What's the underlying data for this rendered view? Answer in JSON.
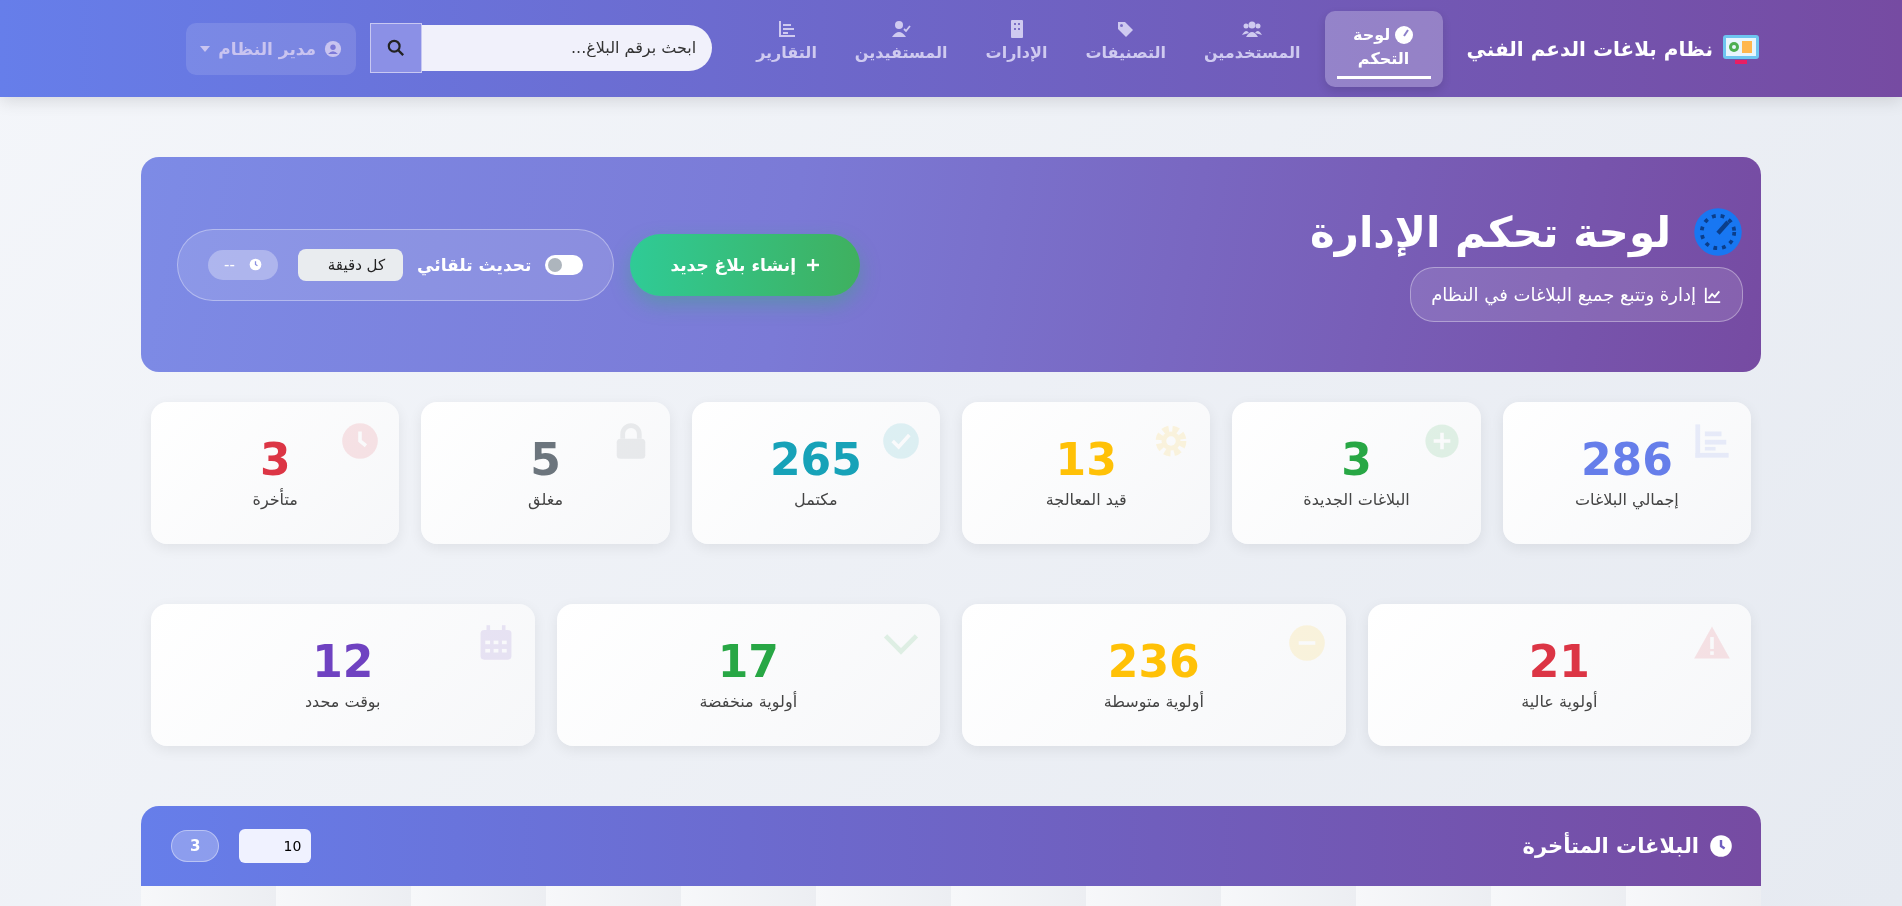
{
  "brand": {
    "title": "نظام بلاغات الدعم الفني"
  },
  "nav": [
    {
      "label": "لوحة التحكم",
      "selected": true
    },
    {
      "label": "المستخدمين",
      "selected": false
    },
    {
      "label": "التصنيفات",
      "selected": false
    },
    {
      "label": "الإدارات",
      "selected": false
    },
    {
      "label": "المستفيدين",
      "selected": false
    },
    {
      "label": "التقارير",
      "selected": false
    }
  ],
  "search": {
    "placeholder": "ابحث برقم البلاغ..."
  },
  "user": {
    "name": "مدير النظام"
  },
  "hero": {
    "title": "لوحة تحكم الإدارة",
    "subtitle": "إدارة وتتبع جميع البلاغات في النظام",
    "create_button": "إنشاء بلاغ جديد",
    "auto_refresh": {
      "label": "تحديث تلقائي",
      "on": false,
      "interval": "كل دقيقة",
      "last_update": "--"
    }
  },
  "stats": [
    {
      "value": "286",
      "label": "إجمالي البلاغات",
      "color": "#667eea"
    },
    {
      "value": "3",
      "label": "البلاغات الجديدة",
      "color": "#28a745"
    },
    {
      "value": "13",
      "label": "قيد المعالجة",
      "color": "#ffc107"
    },
    {
      "value": "265",
      "label": "مكتمل",
      "color": "#17a2b8"
    },
    {
      "value": "5",
      "label": "مغلق",
      "color": "#6c757d"
    },
    {
      "value": "3",
      "label": "متأخرة",
      "color": "#dc3545"
    }
  ],
  "priorities": [
    {
      "value": "21",
      "label": "أولوية عالية",
      "color": "#dc3545"
    },
    {
      "value": "236",
      "label": "أولوية متوسطة",
      "color": "#ffc107"
    },
    {
      "value": "17",
      "label": "أولوية منخفضة",
      "color": "#28a745"
    },
    {
      "value": "12",
      "label": "بوقت محدد",
      "color": "#6f42c1"
    }
  ],
  "overdue": {
    "title": "البلاغات المتأخرة",
    "count": "3",
    "page_size": "10"
  }
}
